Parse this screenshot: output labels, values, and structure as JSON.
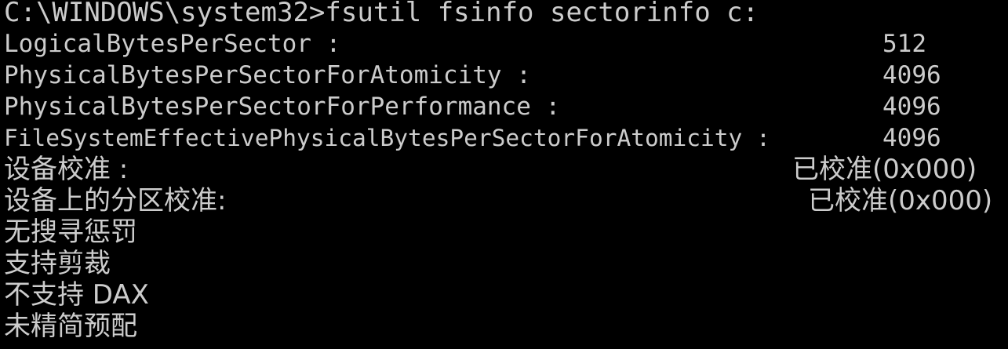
{
  "window": {
    "type": "command-prompt"
  },
  "colors": {
    "background": "#000000",
    "text": "#cccccc"
  },
  "command": {
    "prompt": "C:\\WINDOWS\\system32>",
    "input": "fsutil fsinfo sectorinfo c:"
  },
  "output": [
    {
      "label": "LogicalBytesPerSector :",
      "value": "512"
    },
    {
      "label": "PhysicalBytesPerSectorForAtomicity :",
      "value": "4096"
    },
    {
      "label": "PhysicalBytesPerSectorForPerformance :",
      "value": "4096"
    },
    {
      "label": "FileSystemEffectivePhysicalBytesPerSectorForAtomicity :",
      "value": "4096"
    },
    {
      "label": "设备校准 :",
      "value": "已校准(0x000)"
    },
    {
      "label": "设备上的分区校准:",
      "value": "已校准(0x000)"
    },
    {
      "label": "无搜寻惩罚",
      "value": ""
    },
    {
      "label": "支持剪裁",
      "value": ""
    },
    {
      "label": "不支持 DAX",
      "value": ""
    },
    {
      "label": "未精简预配",
      "value": ""
    }
  ]
}
